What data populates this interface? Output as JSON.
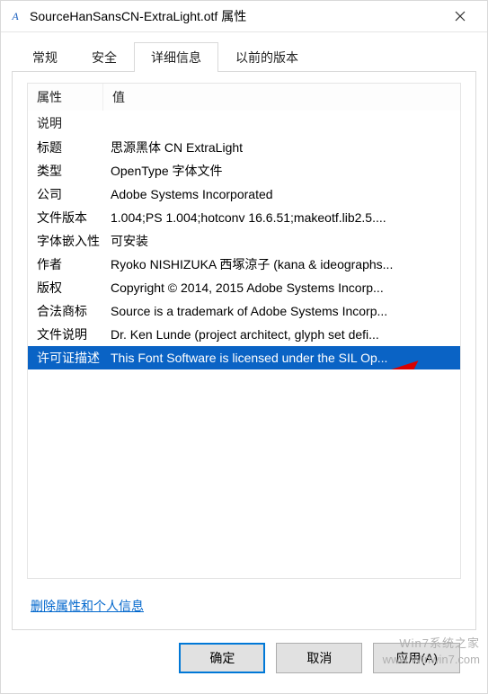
{
  "window": {
    "title": "SourceHanSansCN-ExtraLight.otf 属性",
    "icon_glyph": "A"
  },
  "tabs": {
    "items": [
      {
        "label": "常规"
      },
      {
        "label": "安全"
      },
      {
        "label": "详细信息"
      },
      {
        "label": "以前的版本"
      }
    ],
    "active_index": 2
  },
  "details": {
    "columns": {
      "property": "属性",
      "value": "值"
    },
    "group_label": "说明",
    "rows": [
      {
        "property": "标题",
        "value": "思源黑体 CN ExtraLight"
      },
      {
        "property": "类型",
        "value": "OpenType 字体文件"
      },
      {
        "property": "公司",
        "value": "Adobe Systems Incorporated"
      },
      {
        "property": "文件版本",
        "value": "1.004;PS 1.004;hotconv 16.6.51;makeotf.lib2.5...."
      },
      {
        "property": "字体嵌入性",
        "value": "可安装"
      },
      {
        "property": "作者",
        "value": "Ryoko NISHIZUKA 西塚涼子 (kana & ideographs..."
      },
      {
        "property": "版权",
        "value": "Copyright © 2014, 2015 Adobe Systems Incorp..."
      },
      {
        "property": "合法商标",
        "value": "Source is a trademark of Adobe Systems Incorp..."
      },
      {
        "property": "文件说明",
        "value": "Dr. Ken Lunde (project architect, glyph set defi..."
      },
      {
        "property": "许可证描述",
        "value": "This Font Software is licensed under the SIL Op..."
      }
    ],
    "selected_row_index": 9
  },
  "link": {
    "label": "删除属性和个人信息"
  },
  "buttons": {
    "ok": "确定",
    "cancel": "取消",
    "apply": "应用(A)"
  },
  "watermark": {
    "line1": "Win7系统之家",
    "line2": "www.Winwin7.com"
  }
}
